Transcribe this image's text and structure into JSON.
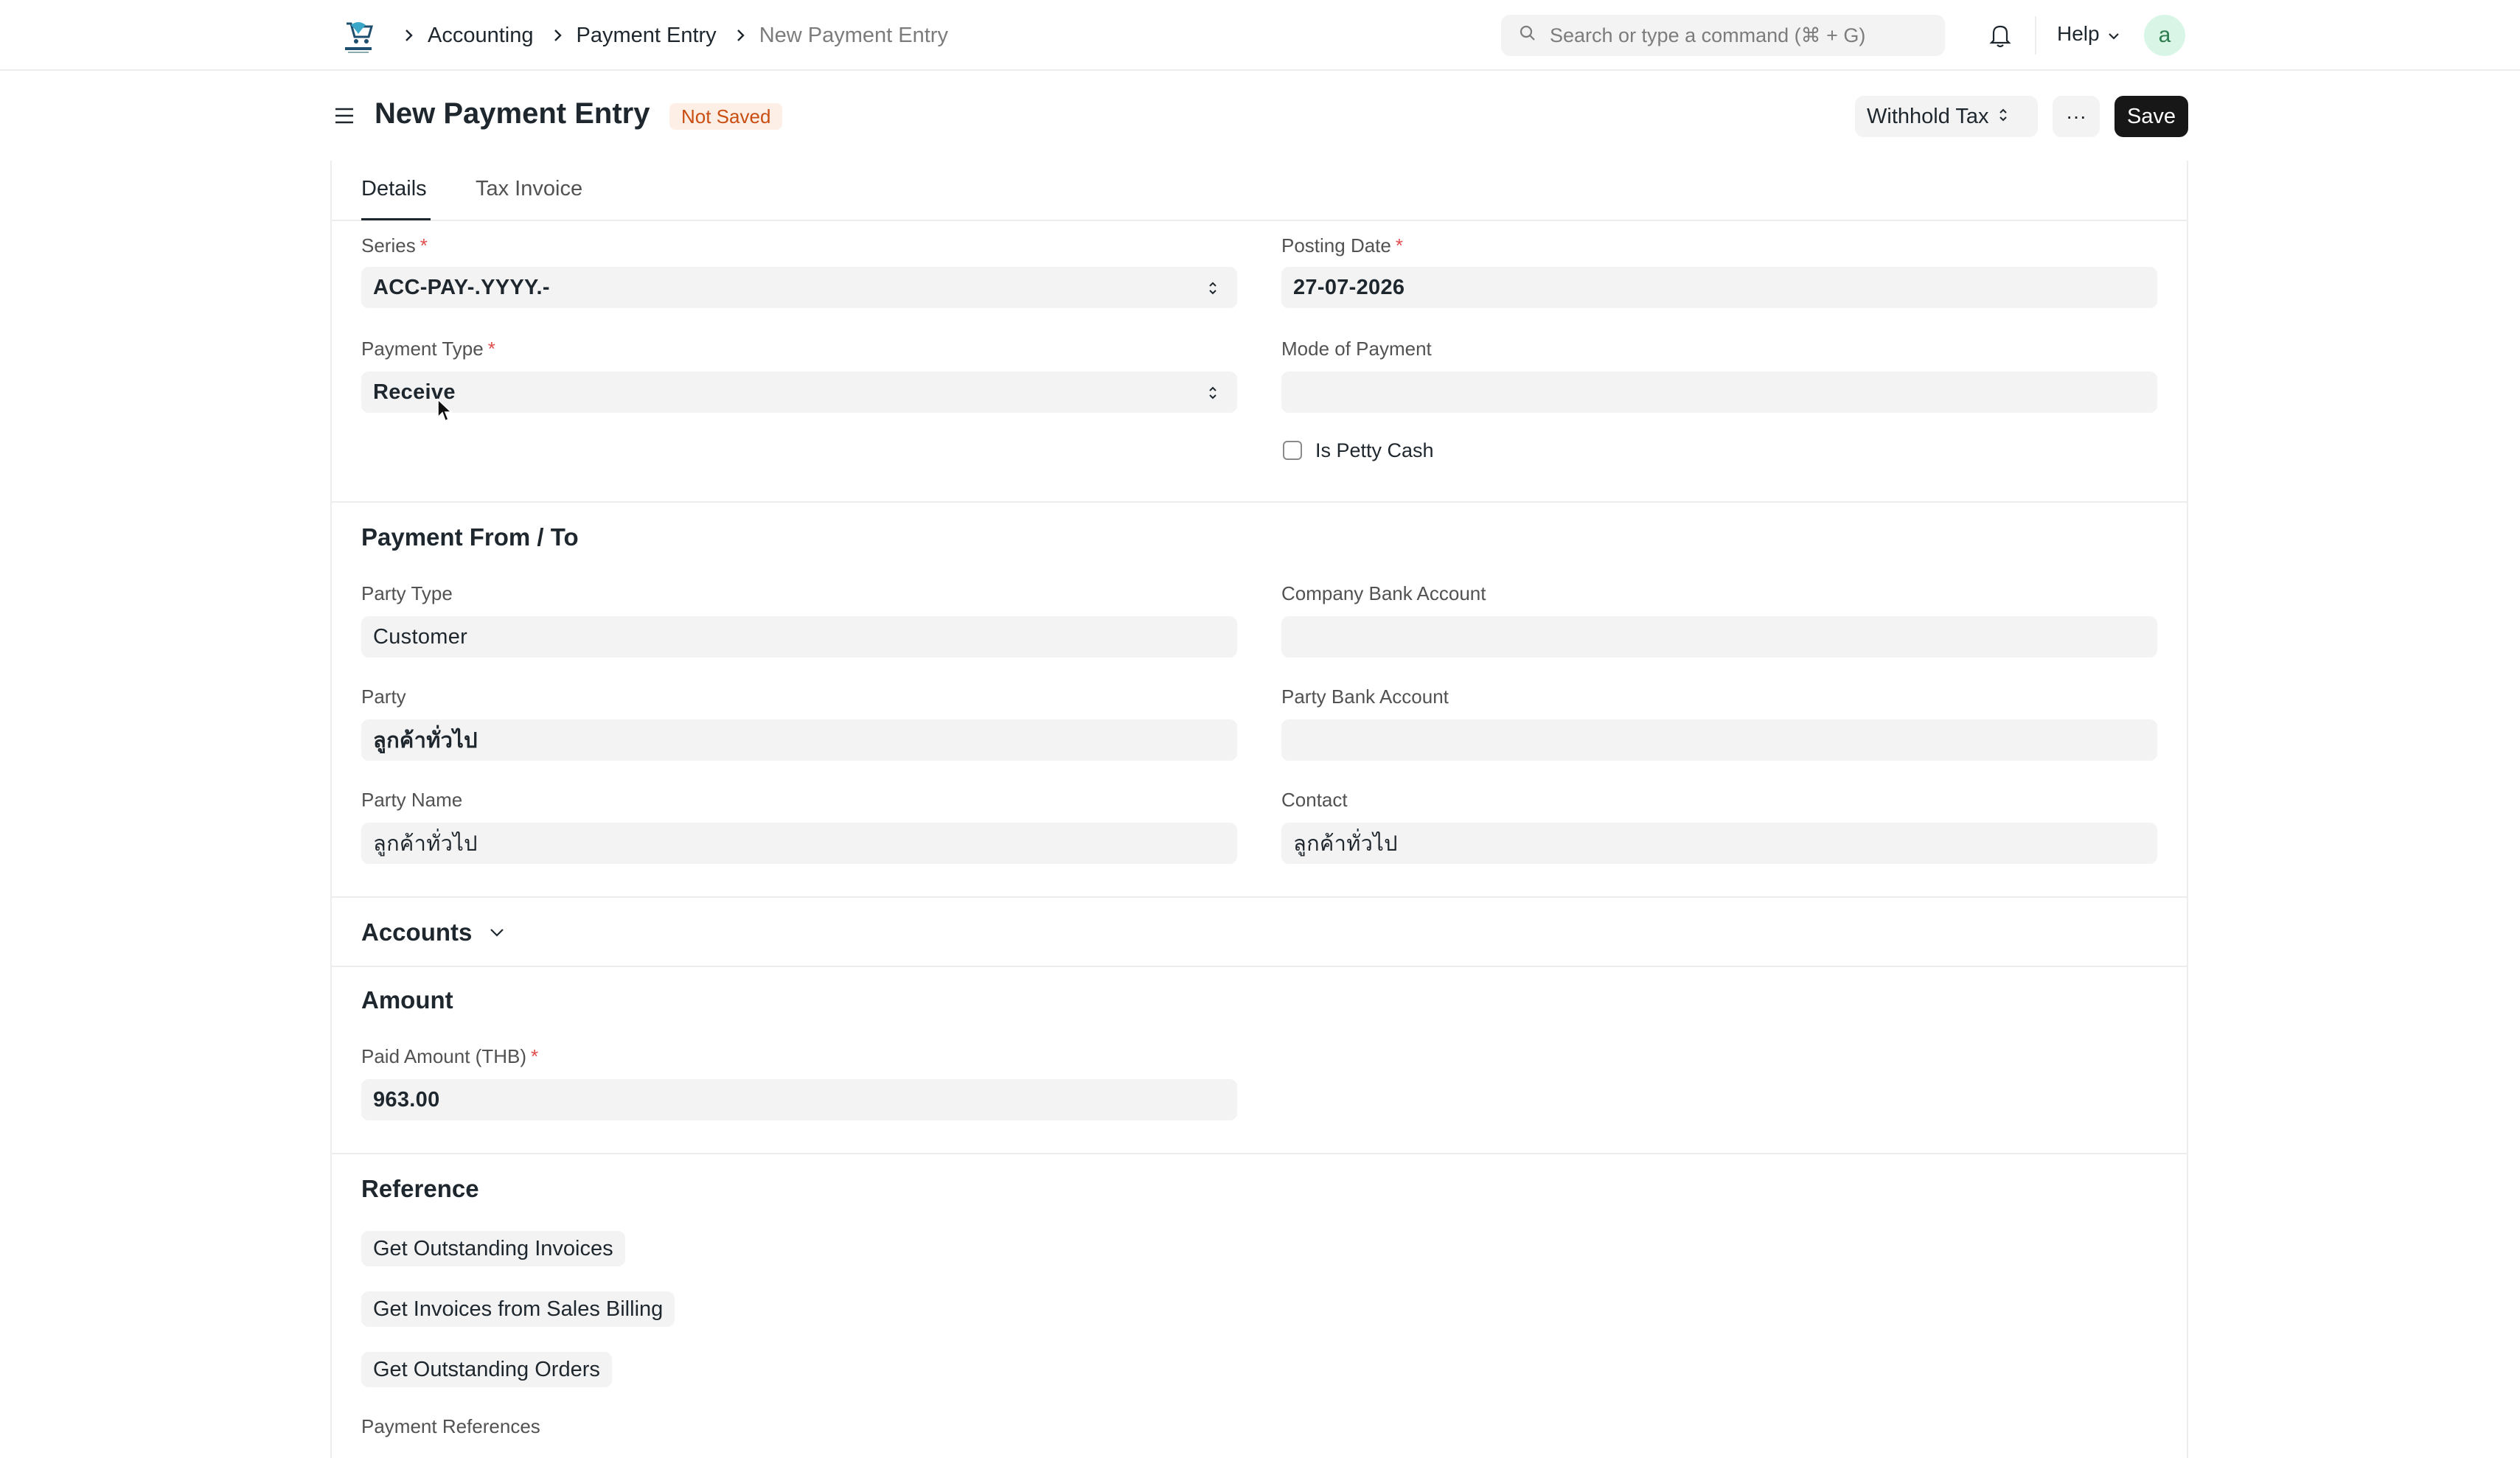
{
  "navbar": {
    "breadcrumbs": [
      "Accounting",
      "Payment Entry",
      "New Payment Entry"
    ],
    "search_placeholder": "Search or type a command (⌘ + G)",
    "help_label": "Help",
    "avatar_letter": "a"
  },
  "page": {
    "title": "New Payment Entry",
    "status": "Not Saved",
    "withhold_tax_label": "Withhold Tax",
    "more_label": "···",
    "save_label": "Save"
  },
  "tabs": [
    {
      "label": "Details",
      "active": true
    },
    {
      "label": "Tax Invoice",
      "active": false
    }
  ],
  "type_section": {
    "series": {
      "label": "Series",
      "value": "ACC-PAY-.YYYY.-"
    },
    "posting_date": {
      "label": "Posting Date",
      "value": "27-07-2026"
    },
    "payment_type": {
      "label": "Payment Type",
      "value": "Receive"
    },
    "mode_of_payment": {
      "label": "Mode of Payment",
      "value": ""
    },
    "is_petty_cash": {
      "label": "Is Petty Cash",
      "checked": false
    }
  },
  "party_section": {
    "title": "Payment From / To",
    "party_type": {
      "label": "Party Type",
      "value": "Customer"
    },
    "company_bank_account": {
      "label": "Company Bank Account",
      "value": ""
    },
    "party": {
      "label": "Party",
      "value": "ลูกค้าทั่วไป"
    },
    "party_bank_account": {
      "label": "Party Bank Account",
      "value": ""
    },
    "party_name": {
      "label": "Party Name",
      "value": "ลูกค้าทั่วไป"
    },
    "contact": {
      "label": "Contact",
      "value": "ลูกค้าทั่วไป"
    }
  },
  "accounts_section": {
    "title": "Accounts"
  },
  "amount_section": {
    "title": "Amount",
    "paid_amount": {
      "label": "Paid Amount (THB)",
      "value": "963.00"
    }
  },
  "reference_section": {
    "title": "Reference",
    "buttons": [
      "Get Outstanding Invoices",
      "Get Invoices from Sales Billing",
      "Get Outstanding Orders"
    ],
    "payment_references_label": "Payment References"
  },
  "colors": {
    "primary_button": "#171717",
    "status_badge_bg": "#fdeee6",
    "status_badge_text": "#c94e12",
    "required_mark": "#e24c4c",
    "field_bg": "#f3f3f3"
  },
  "icons": [
    "app-logo-icon",
    "chevron-right-icon",
    "search-icon",
    "bell-icon",
    "chevron-down-icon",
    "hamburger-icon",
    "select-arrows-icon",
    "mouse-cursor-icon"
  ]
}
